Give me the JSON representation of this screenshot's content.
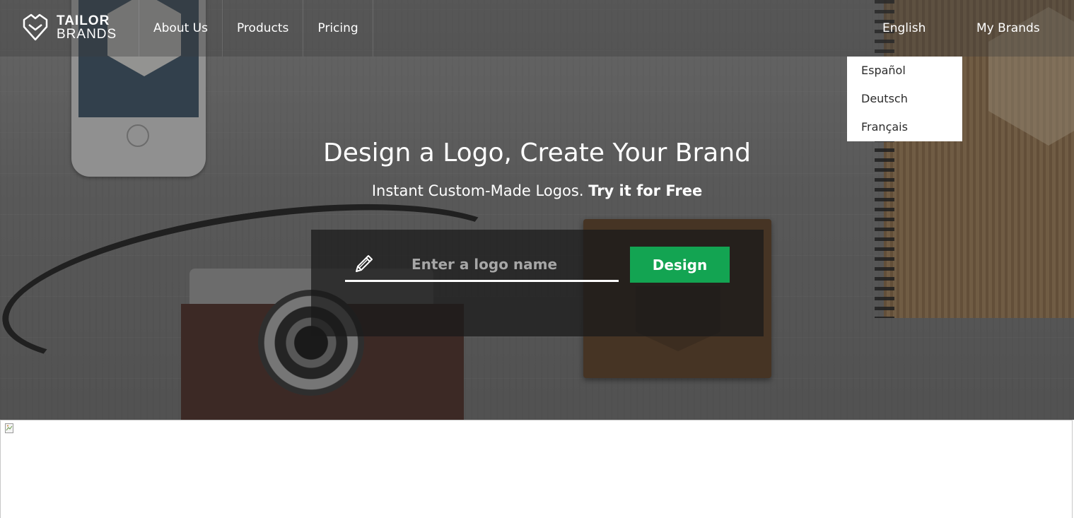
{
  "brand": {
    "name_line1": "TAILOR",
    "name_line2": "BRANDS"
  },
  "nav": {
    "links": [
      "About Us",
      "Products",
      "Pricing"
    ],
    "language": "English",
    "my_brands": "My Brands"
  },
  "language_menu": {
    "items": [
      "Español",
      "Deutsch",
      "Français"
    ]
  },
  "hero": {
    "title": "Design a Logo, Create Your Brand",
    "subtitle_plain": "Instant Custom-Made Logos.",
    "subtitle_bold": "Try it for Free",
    "input_placeholder": "Enter a logo name",
    "input_value": "",
    "cta_label": "Design"
  },
  "colors": {
    "accent_green": "#13a452",
    "text_white": "#ffffff"
  },
  "icons": {
    "logo": "tailor-brands-logo-icon",
    "pencil": "pencil-icon",
    "broken_image": "broken-image-icon"
  }
}
